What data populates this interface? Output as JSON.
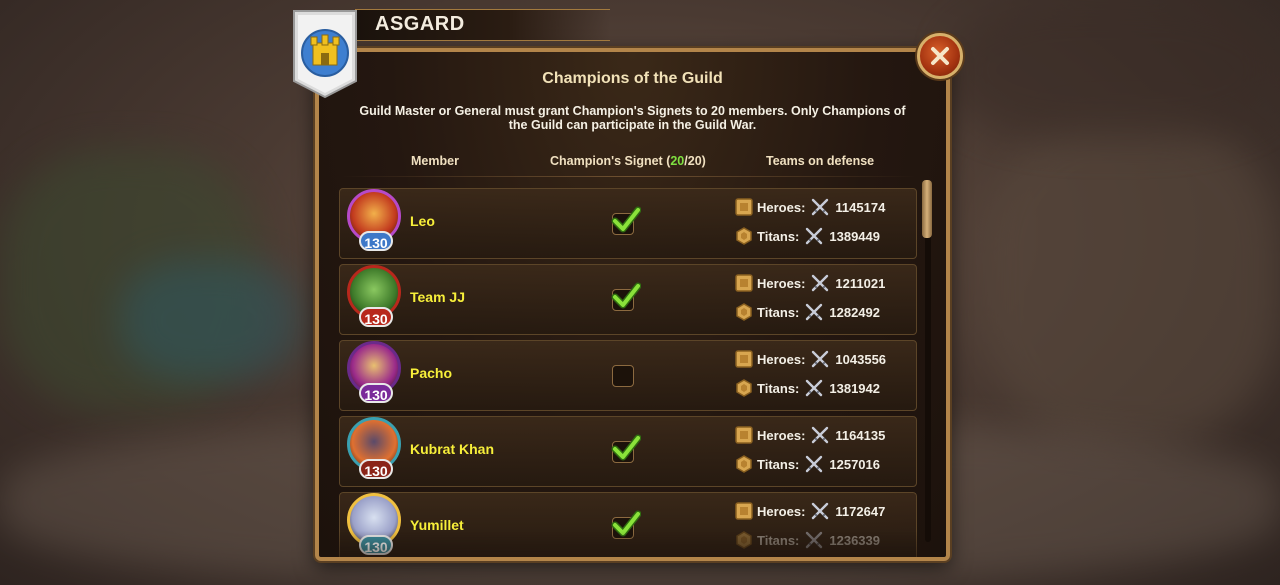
{
  "guild": {
    "name": "ASGARD"
  },
  "dialog": {
    "title": "Champions of the Guild",
    "description": "Guild Master or General must grant Champion's Signets to 20 members. Only Champions of the Guild can participate in the Guild War."
  },
  "columns": {
    "member": "Member",
    "signet_label": "Champion's Signet",
    "signet_count": "20",
    "signet_total": "/20)",
    "signet_open": "(",
    "teams": "Teams on defense"
  },
  "labels": {
    "heroes": "Heroes:",
    "titans": "Titans:"
  },
  "members": [
    {
      "name": "Leo",
      "level": "130",
      "signet": true,
      "heroes": "1145174",
      "titans": "1389449",
      "level_color": "#3d78c8"
    },
    {
      "name": "Team JJ",
      "level": "130",
      "signet": true,
      "heroes": "1211021",
      "titans": "1282492",
      "level_color": "#b8281c"
    },
    {
      "name": "Pacho",
      "level": "130",
      "signet": false,
      "heroes": "1043556",
      "titans": "1381942",
      "level_color": "#7a2a9a"
    },
    {
      "name": "Kubrat Khan",
      "level": "130",
      "signet": true,
      "heroes": "1164135",
      "titans": "1257016",
      "level_color": "#8a2418"
    },
    {
      "name": "Yumillet",
      "level": "130",
      "signet": true,
      "heroes": "1172647",
      "titans": "1236339",
      "level_color": "#3a8a9a"
    }
  ],
  "colors": {
    "accent_gold": "#b3854a",
    "name_yellow": "#f7ef3a",
    "signet_green": "#7fe040"
  },
  "icons": {
    "close": "close-icon",
    "heroes": "hero-shield-icon",
    "titans": "titan-hex-icon",
    "power": "crossed-swords-icon",
    "check": "checkmark-icon"
  }
}
